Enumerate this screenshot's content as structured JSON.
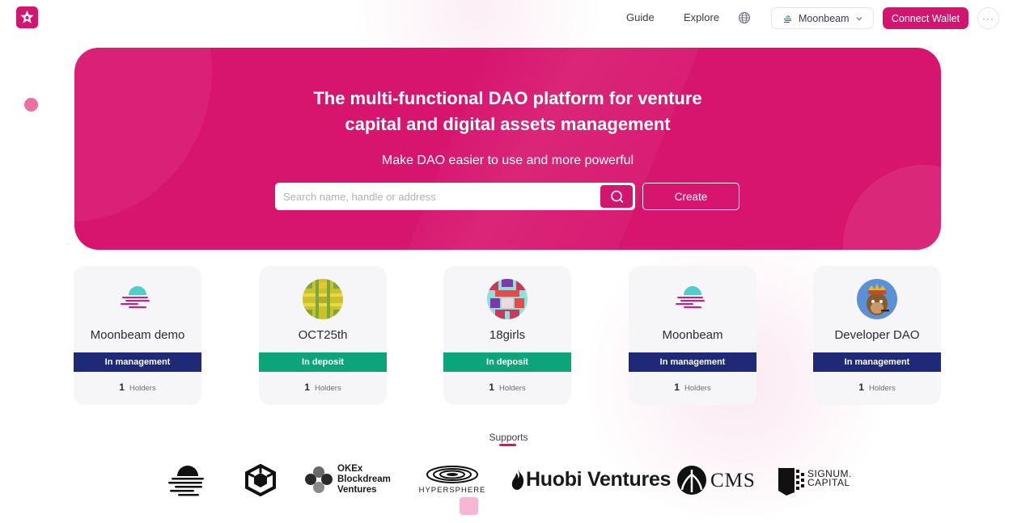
{
  "header": {
    "nav": {
      "guide": "Guide",
      "explore": "Explore"
    },
    "network": "Moonbeam",
    "connect_label": "Connect Wallet",
    "more": "···"
  },
  "hero": {
    "title_line1": "The multi-functional DAO platform for venture",
    "title_line2": "capital and digital assets management",
    "subtitle": "Make DAO easier to use and more powerful",
    "search_placeholder": "Search name, handle or address",
    "create_label": "Create"
  },
  "daos": [
    {
      "name": "Moonbeam demo",
      "status": "In management",
      "holders_count": "1",
      "holders_label": "Holders",
      "icon": "moonbeam-icon"
    },
    {
      "name": "OCT25th",
      "status": "In deposit",
      "holders_count": "1",
      "holders_label": "Holders",
      "icon": "grid-avatar-icon"
    },
    {
      "name": "18girls",
      "status": "In deposit",
      "holders_count": "1",
      "holders_label": "Holders",
      "icon": "pixel-avatar-icon"
    },
    {
      "name": "Moonbeam",
      "status": "In management",
      "holders_count": "1",
      "holders_label": "Holders",
      "icon": "moonbeam-icon"
    },
    {
      "name": "Developer DAO",
      "status": "In management",
      "holders_count": "1",
      "holders_label": "Holders",
      "icon": "ape-avatar-icon"
    }
  ],
  "supports": {
    "title": "Supports",
    "sponsors": [
      {
        "icon": "moonbeam-logo"
      },
      {
        "icon": "cube-logo"
      },
      {
        "icon": "okex-logo",
        "text": [
          "OKEx",
          "Blockdream",
          "Ventures"
        ]
      },
      {
        "icon": "hypersphere-logo",
        "text": "HYPERSPHERE"
      },
      {
        "icon": "huobi-logo",
        "text": "Huobi Ventures"
      },
      {
        "icon": "cms-logo",
        "text": "CMS"
      },
      {
        "icon": "signum-logo",
        "text": [
          "SIGNUM.",
          "CAPITAL"
        ]
      }
    ]
  },
  "colors": {
    "brand": "#d4156f",
    "management": "#1e2a78",
    "deposit": "#0ca57a"
  }
}
